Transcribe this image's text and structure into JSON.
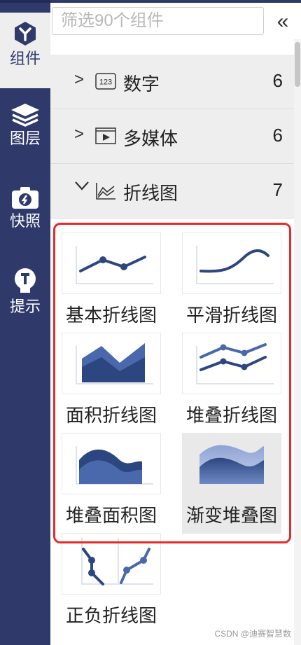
{
  "nav": {
    "items": [
      {
        "label": "组件",
        "icon": "component-icon",
        "active": true
      },
      {
        "label": "图层",
        "icon": "layers-icon",
        "active": false
      },
      {
        "label": "快照",
        "icon": "camera-icon",
        "active": false
      },
      {
        "label": "提示",
        "icon": "hint-bulb-icon",
        "active": false
      }
    ]
  },
  "search": {
    "placeholder": "筛选90个组件"
  },
  "collapse": {
    "label": "«"
  },
  "categories": [
    {
      "name": "数字",
      "count": "6",
      "icon": "number-123-icon",
      "expanded": false
    },
    {
      "name": "多媒体",
      "count": "6",
      "icon": "media-play-icon",
      "expanded": false
    },
    {
      "name": "折线图",
      "count": "7",
      "icon": "line-chart-icon",
      "expanded": true
    }
  ],
  "components": [
    {
      "label": "基本折线图"
    },
    {
      "label": "平滑折线图"
    },
    {
      "label": "面积折线图"
    },
    {
      "label": "堆叠折线图"
    },
    {
      "label": "堆叠面积图"
    },
    {
      "label": "渐变堆叠图"
    },
    {
      "label": "正负折线图"
    }
  ],
  "watermark": "CSDN @迪赛智慧数",
  "colors": {
    "rail": "#2f3a6b",
    "accent_line": "#2c4680",
    "highlight": "#ea2a2a"
  }
}
